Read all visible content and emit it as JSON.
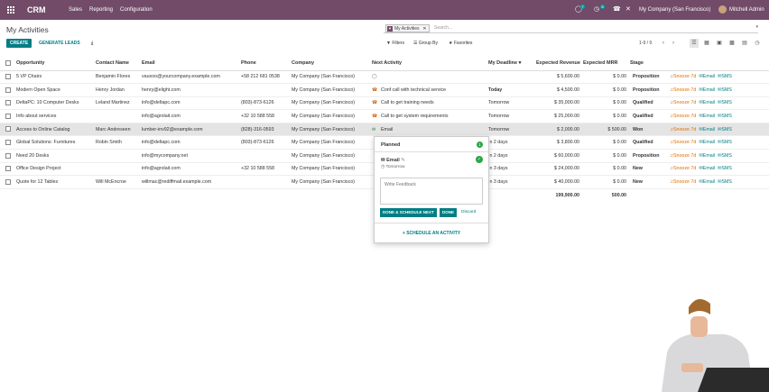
{
  "topbar": {
    "app": "CRM",
    "menus": [
      "Sales",
      "Reporting",
      "Configuration"
    ],
    "chat_count": "7",
    "activity_count": "6",
    "company": "My Company (San Francisco)",
    "user": "Mitchell Admin"
  },
  "page": {
    "title": "My Activities"
  },
  "search": {
    "facet": "My Activities",
    "placeholder": "Search..."
  },
  "buttons": {
    "create": "CREATE",
    "generate": "GENERATE LEADS"
  },
  "filters": {
    "filters": "Filters",
    "group_by": "Group By",
    "favorites": "Favorites"
  },
  "pager": {
    "range": "1-9 / 9"
  },
  "columns": {
    "opportunity": "Opportunity",
    "contact": "Contact Name",
    "email": "Email",
    "phone": "Phone",
    "company": "Company",
    "next_activity": "Next Activity",
    "deadline": "My Deadline",
    "revenue": "Expected Revenue",
    "mrr": "Expected MRR",
    "stage": "Stage"
  },
  "actions": {
    "snooze": "Snooze 7d",
    "email": "Email",
    "sms": "SMS"
  },
  "rows": [
    {
      "opportunity": "5 VP Chairs",
      "contact": "Benjamin Flores",
      "email": "vauxoo@yourcompany.example.com",
      "phone": "+58 212 681 0538",
      "company": "My Company (San Francisco)",
      "activity": "",
      "activity_kind": "none",
      "deadline": "",
      "today": false,
      "revenue": "$ 5,600.00",
      "mrr": "$ 0.00",
      "stage": "Proposition"
    },
    {
      "opportunity": "Modern Open Space",
      "contact": "Henry Jordan",
      "email": "henry@elight.com",
      "phone": "",
      "company": "My Company (San Francisco)",
      "activity": "Conf call with technical service",
      "activity_kind": "phone",
      "deadline": "Today",
      "today": true,
      "revenue": "$ 4,500.00",
      "mrr": "$ 0.00",
      "stage": "Proposition"
    },
    {
      "opportunity": "DeltaPC: 10 Computer Desks",
      "contact": "Leland Martinez",
      "email": "info@deltapc.com",
      "phone": "(803)-873-6126",
      "company": "My Company (San Francisco)",
      "activity": "Call to get training needs",
      "activity_kind": "phone",
      "deadline": "Tomorrow",
      "today": false,
      "revenue": "$ 35,000.00",
      "mrr": "$ 0.00",
      "stage": "Qualified"
    },
    {
      "opportunity": "Info about services",
      "contact": "",
      "email": "info@agrolait.com",
      "phone": "+32 10 588 558",
      "company": "My Company (San Francisco)",
      "activity": "Call to get system requirements",
      "activity_kind": "phone",
      "deadline": "Tomorrow",
      "today": false,
      "revenue": "$ 25,000.00",
      "mrr": "$ 0.00",
      "stage": "Qualified"
    },
    {
      "opportunity": "Access to Online Catalog",
      "contact": "Marc Andreseen",
      "email": "lumber-inv92@example.com",
      "phone": "(828)-316-0593",
      "company": "My Company (San Francisco)",
      "activity": "Email",
      "activity_kind": "mail",
      "deadline": "Tomorrow",
      "today": false,
      "revenue": "$ 2,000.00",
      "mrr": "$ 500.00",
      "stage": "Won"
    },
    {
      "opportunity": "Global Solutions: Furnitures",
      "contact": "Robin Smith",
      "email": "info@deltapc.com",
      "phone": "(803)-873-6126",
      "company": "My Company (San Francisco)",
      "activity": "",
      "activity_kind": "none",
      "deadline": "In 2 days",
      "today": false,
      "revenue": "$ 3,800.00",
      "mrr": "$ 0.00",
      "stage": "Qualified"
    },
    {
      "opportunity": "Need 20 Desks",
      "contact": "",
      "email": "info@mycompany.net",
      "phone": "",
      "company": "My Company (San Francisco)",
      "activity": "",
      "activity_kind": "none",
      "deadline": "In 2 days",
      "today": false,
      "revenue": "$ 60,000.00",
      "mrr": "$ 0.00",
      "stage": "Proposition"
    },
    {
      "opportunity": "Office Design Project",
      "contact": "",
      "email": "info@agrolait.com",
      "phone": "+32 10 588 558",
      "company": "My Company (San Francisco)",
      "activity": "",
      "activity_kind": "none",
      "deadline": "In 3 days",
      "today": false,
      "revenue": "$ 24,000.00",
      "mrr": "$ 0.00",
      "stage": "New"
    },
    {
      "opportunity": "Quote for 12 Tables",
      "contact": "Will McEncroe",
      "email": "willmac@rediffmail.example.com",
      "phone": "",
      "company": "My Company (San Francisco)",
      "activity": "",
      "activity_kind": "none",
      "deadline": "In 3 days",
      "today": false,
      "revenue": "$ 40,000.00",
      "mrr": "$ 0.00",
      "stage": "New"
    }
  ],
  "totals": {
    "revenue": "199,900.00",
    "mrr": "500.00"
  },
  "popover": {
    "title": "Planned",
    "count": "1",
    "activity_type": "Email",
    "activity_date": "Tomorrow",
    "feedback_placeholder": "Write Feedback",
    "done_schedule": "DONE & SCHEDULE NEXT",
    "done": "DONE",
    "discard": "Discard",
    "schedule": "+ SCHEDULE AN ACTIVITY"
  }
}
